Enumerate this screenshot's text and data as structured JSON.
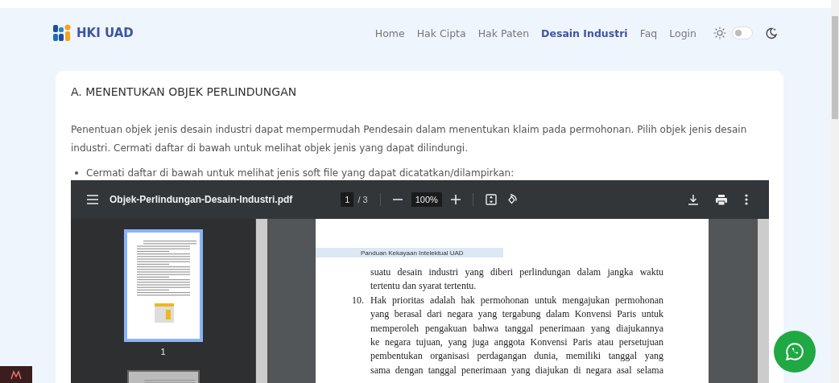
{
  "header": {
    "logo": "HKI UAD",
    "nav": [
      {
        "label": "Home",
        "selected": false
      },
      {
        "label": "Hak Cipta",
        "selected": false
      },
      {
        "label": "Hak Paten",
        "selected": false
      },
      {
        "label": "Desain Industri",
        "selected": true
      },
      {
        "label": "Faq",
        "selected": false
      },
      {
        "label": "Login",
        "selected": false
      }
    ],
    "theme_toggle": {
      "on": false
    }
  },
  "section": {
    "title": "A. MENENTUKAN OBJEK PERLINDUNGAN",
    "intro": "Penentuan objek jenis desain industri dapat mempermudah Pendesain dalam menentukan klaim pada permohonan. Pilih objek jenis desain industri. Cermati daftar di bawah untuk melihat objek jenis yang dapat dilindungi.",
    "bullet": "Cermati daftar di bawah untuk melihat jenis soft file yang dapat dicatatkan/dilampirkan:"
  },
  "pdf_viewer": {
    "filename": "Objek-Perlindungan-Desain-Industri.pdf",
    "page_input": "1",
    "page_total": "/ 3",
    "zoom": "100%",
    "thumbnails": [
      {
        "label": "1",
        "selected": true
      },
      {
        "selected": false
      }
    ],
    "page": {
      "header": "Panduan Kekayaan Intelektual UAD",
      "items": [
        {
          "continues": false,
          "lines": [
            "suatu desain industri yang diberi perlindungan dalam jangka waktu",
            "tertentu dan syarat tertentu."
          ]
        },
        {
          "number": "10.",
          "continues": true,
          "lines": [
            "Hak prioritas adalah hak permohonan untuk mengajukan permohonan",
            "yang berasal dari negara yang tergabung dalam Konvensi Paris untuk",
            "memperoleh pengakuan bahwa tanggal penerimaan yang diajukannya",
            "ke negara tujuan, yang juga anggota Konvensi Paris atau persetujuan",
            "pembentukan organisasi perdagangan dunia, memiliki tanggal yang",
            "sama dengan tanggal penerimaan yang diajukan di negara asal selama"
          ]
        }
      ]
    }
  }
}
